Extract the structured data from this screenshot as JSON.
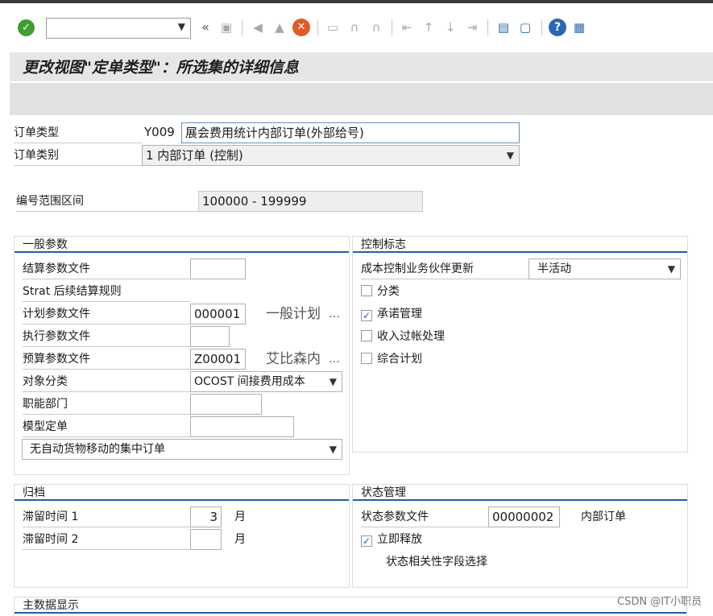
{
  "toolbar": {
    "command_field": "",
    "icons": [
      "ok-icon",
      "back-icon",
      "save-icon",
      "exit-icon",
      "back-green-icon",
      "cancel-icon",
      "print-icon",
      "find-icon",
      "find-next-icon",
      "first-page-icon",
      "prev-page-icon",
      "next-page-icon",
      "last-page-icon",
      "create-session-icon",
      "shortcut-icon",
      "help-icon",
      "customize-layout-icon"
    ]
  },
  "title": "更改视图\"定单类型\"：所选集的详细信息",
  "header": {
    "order_type_label": "订单类型",
    "order_type_code": "Y009",
    "order_type_name": "展会费用统计内部订单(外部给号)",
    "order_category_label": "订单类别",
    "order_category_value": "1 内部订单 (控制)",
    "number_range_label": "编号范围区间",
    "number_range_value": "100000  -  199999"
  },
  "general": {
    "heading": "一般参数",
    "settlement_profile_label": "结算参数文件",
    "settlement_profile_value": "",
    "strat_label": "Strat 后续结算规则",
    "planning_profile_label": "计划参数文件",
    "planning_profile_value": "000001",
    "planning_profile_desc": "一般计划",
    "execution_profile_label": "执行参数文件",
    "execution_profile_value": "",
    "budget_profile_label": "预算参数文件",
    "budget_profile_value": "Z00001",
    "budget_profile_desc": "艾比森内",
    "object_class_label": "对象分类",
    "object_class_value": "OCOST 间接费用成本",
    "functional_area_label": "职能部门",
    "functional_area_value": "",
    "model_order_label": "模型定单",
    "model_order_value": "",
    "collective_order_value": "无自动货物移动的集中订单"
  },
  "control": {
    "heading": "控制标志",
    "partner_update_label": "成本控制业务伙伴更新",
    "partner_update_value": "半活动",
    "classification_label": "分类",
    "classification_checked": false,
    "commitment_label": "承诺管理",
    "commitment_checked": true,
    "revenue_posting_label": "收入过帐处理",
    "revenue_posting_checked": false,
    "integrated_planning_label": "综合计划",
    "integrated_planning_checked": false
  },
  "archiving": {
    "heading": "归档",
    "residence1_label": "滞留时间 1",
    "residence1_value": "3",
    "residence1_unit": "月",
    "residence2_label": "滞留时间 2",
    "residence2_value": "",
    "residence2_unit": "月"
  },
  "status": {
    "heading": "状态管理",
    "status_profile_label": "状态参数文件",
    "status_profile_value": "00000002",
    "status_profile_desc": "内部订单",
    "release_immediately_label": "立即释放",
    "release_immediately_checked": true,
    "field_selection_label": "状态相关性字段选择"
  },
  "master_data": {
    "heading": "主数据显示"
  },
  "watermark": "CSDN @IT小职员"
}
